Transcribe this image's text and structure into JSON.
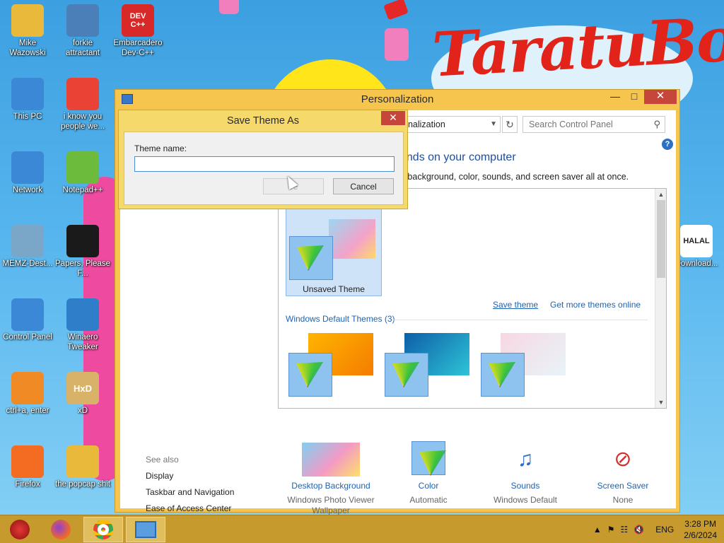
{
  "wallpaper": {
    "logo_text": "TaratuBong!"
  },
  "desktop_icons": [
    {
      "label": "Mike Wazowski",
      "icon": "folder-user-icon",
      "color": "#e8b93a"
    },
    {
      "label": "forkie attractant",
      "icon": "gear-monitor-icon",
      "color": "#4b7fb8"
    },
    {
      "label": "Embarcadero Dev-C++",
      "icon": "devcpp-icon",
      "color": "#d82828",
      "glyph": "DEV C++"
    },
    {
      "label": "This PC",
      "icon": "computer-icon",
      "color": "#3b88d6"
    },
    {
      "label": "i know you people we...",
      "icon": "chrome-icon",
      "color": "#ea4335"
    },
    {
      "label": "Network",
      "icon": "network-icon",
      "color": "#3b88d6"
    },
    {
      "label": "Notepad++",
      "icon": "notepadpp-icon",
      "color": "#6cbb3c"
    },
    {
      "label": "MEMZ-Dest...",
      "icon": "recycle-bin-icon",
      "color": "#7aa6c8"
    },
    {
      "label": "Papers, Please F...",
      "icon": "papers-please-icon",
      "color": "#1a1a1a"
    },
    {
      "label": "Control Panel",
      "icon": "control-panel-icon",
      "color": "#3b88d6"
    },
    {
      "label": "Winaero Tweaker",
      "icon": "winaero-icon",
      "color": "#2e7ec9"
    },
    {
      "label": "ctrl+a, enter",
      "icon": "magnifier-icon",
      "color": "#f08a24"
    },
    {
      "label": "xD",
      "icon": "hxd-icon",
      "color": "#d9b26a",
      "glyph": "HxD"
    },
    {
      "label": "Firefox",
      "icon": "firefox-icon",
      "color": "#f36c21"
    },
    {
      "label": "the popcap shit",
      "icon": "folder-icon",
      "color": "#e8b93a"
    },
    {
      "label": "Download...",
      "icon": "halal-icon",
      "color": "#ffffff",
      "glyph": "HALAL"
    }
  ],
  "window": {
    "title": "Personalization",
    "address_text": "onalization",
    "search_placeholder": "Search Control Panel",
    "headline": "unds on your computer",
    "subline": "p background, color, sounds, and screen saver all at once.",
    "unsaved_theme": "Unsaved Theme",
    "save_theme_link": "Save theme",
    "get_more_link": "Get more themes online",
    "default_group": "Windows Default Themes (3)",
    "see_also": {
      "heading": "See also",
      "items": [
        "Display",
        "Taskbar and Navigation",
        "Ease of Access Center"
      ]
    },
    "bottom_items": [
      {
        "name": "Desktop Background",
        "value": "Windows Photo Viewer Wallpaper"
      },
      {
        "name": "Color",
        "value": "Automatic"
      },
      {
        "name": "Sounds",
        "value": "Windows Default"
      },
      {
        "name": "Screen Saver",
        "value": "None"
      }
    ]
  },
  "dialog": {
    "title": "Save Theme As",
    "label": "Theme name:",
    "input_value": "",
    "save_label": "Save",
    "save_visible_text": "ve",
    "cancel_label": "Cancel"
  },
  "taskbar": {
    "tray": {
      "language": "ENG",
      "time": "3:28 PM",
      "date": "2/6/2024"
    }
  }
}
